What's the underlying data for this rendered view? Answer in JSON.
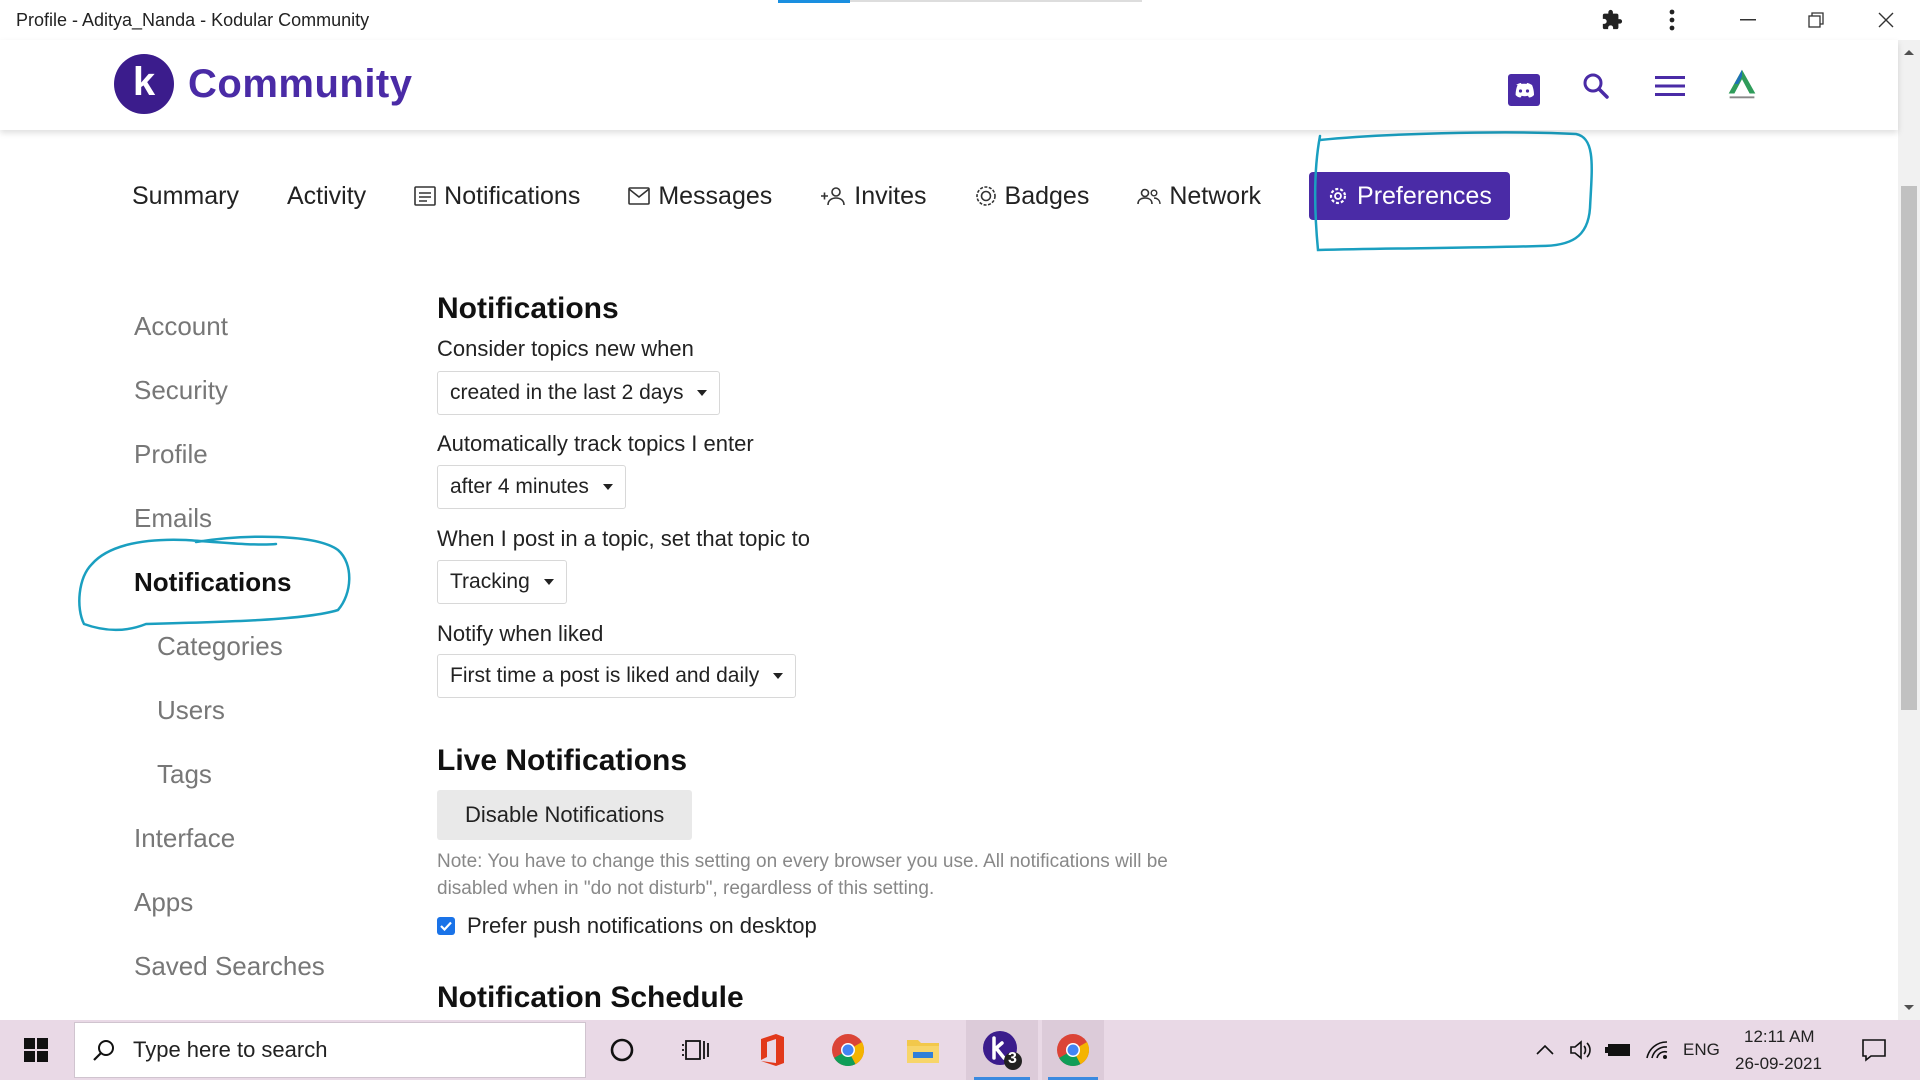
{
  "window": {
    "title": "Profile - Aditya_Nanda - Kodular Community",
    "icons": [
      "puzzle-icon",
      "more-vertical-icon",
      "minimize-icon",
      "restore-icon",
      "close-icon"
    ]
  },
  "header": {
    "logo_letter": "k",
    "logo_text": "Community",
    "icons": [
      "discord-icon",
      "search-icon",
      "hamburger-menu-icon",
      "user-avatar"
    ]
  },
  "profile_nav": {
    "items": [
      {
        "label": "Summary",
        "icon": ""
      },
      {
        "label": "Activity",
        "icon": ""
      },
      {
        "label": "Notifications",
        "icon": "notification-list-icon"
      },
      {
        "label": "Messages",
        "icon": "envelope-icon"
      },
      {
        "label": "Invites",
        "icon": "user-plus-icon"
      },
      {
        "label": "Badges",
        "icon": "badge-icon"
      },
      {
        "label": "Network",
        "icon": "users-icon"
      },
      {
        "label": "Preferences",
        "icon": "gear-icon",
        "active": true
      }
    ]
  },
  "sidebar": {
    "items": [
      {
        "label": "Account"
      },
      {
        "label": "Security"
      },
      {
        "label": "Profile"
      },
      {
        "label": "Emails"
      },
      {
        "label": "Notifications",
        "active": true
      },
      {
        "label": "Categories",
        "sub": true
      },
      {
        "label": "Users",
        "sub": true
      },
      {
        "label": "Tags",
        "sub": true
      },
      {
        "label": "Interface"
      },
      {
        "label": "Apps"
      },
      {
        "label": "Saved Searches"
      }
    ]
  },
  "content": {
    "notifications_heading": "Notifications",
    "consider_new_label": "Consider topics new when",
    "consider_new_value": "created in the last 2 days",
    "auto_track_label": "Automatically track topics I enter",
    "auto_track_value": "after 4 minutes",
    "post_in_topic_label": "When I post in a topic, set that topic to",
    "post_in_topic_value": "Tracking",
    "notify_liked_label": "Notify when liked",
    "notify_liked_value": "First time a post is liked and daily",
    "live_heading": "Live Notifications",
    "disable_button": "Disable Notifications",
    "note": "Note: You have to change this setting on every browser you use. All notifications will be disabled when in \"do not disturb\", regardless of this setting.",
    "prefer_push_label": "Prefer push notifications on desktop",
    "prefer_push_checked": true,
    "schedule_heading": "Notification Schedule"
  },
  "taskbar": {
    "search_placeholder": "Type here to search",
    "badge_count": "3",
    "language": "ENG",
    "time": "12:11 AM",
    "date": "26-09-2021"
  },
  "colors": {
    "brand": "#4a2ba6",
    "annotation": "#1a9fc0",
    "taskbar": "#e9d9e6"
  }
}
